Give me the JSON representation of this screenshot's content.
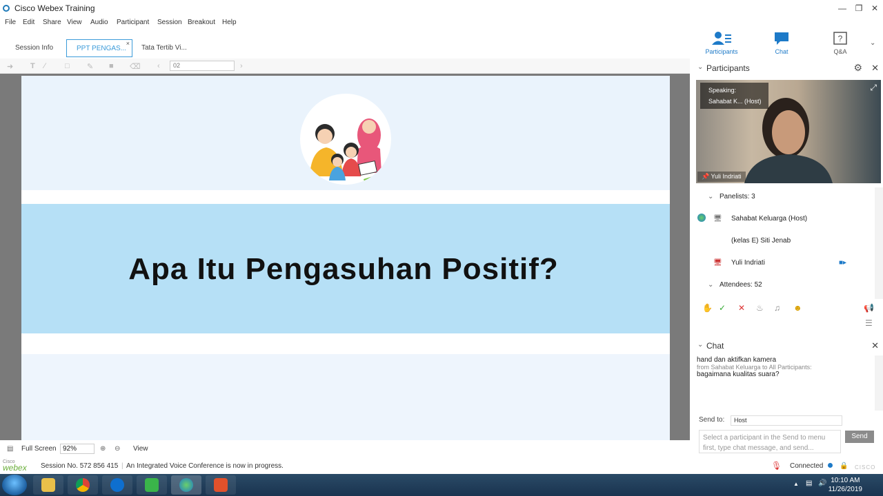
{
  "window": {
    "title": "Cisco Webex Training"
  },
  "menu": [
    "File",
    "Edit",
    "Share",
    "View",
    "Audio",
    "Participant",
    "Session",
    "Breakout",
    "Help"
  ],
  "tabs": [
    {
      "label": "Session Info"
    },
    {
      "label": "PPT PENGAS...",
      "active": true
    },
    {
      "label": "Tata Tertib Vi..."
    }
  ],
  "top_buttons": {
    "participants": "Participants",
    "chat": "Chat",
    "qa": "Q&A"
  },
  "toolbar": {
    "page": "02"
  },
  "slide": {
    "headline": "Apa Itu Pengasuhan Positif?"
  },
  "bottom_bar": {
    "fullscreen": "Full Screen",
    "zoom": "92%",
    "view": "View"
  },
  "status": {
    "brand_top": "Cisco",
    "brand": "webex",
    "session": "Session No. 572 856 415",
    "message": "An Integrated Voice Conference is now in progress.",
    "connected": "Connected",
    "cisco": "CISCO"
  },
  "participants_panel": {
    "title": "Participants",
    "speaking_label": "Speaking:",
    "speaking_name": "Sahabat K... (Host)",
    "video_name": "Yuli Indriati",
    "panelists_label": "Panelists: 3",
    "panelists": [
      "Sahabat Keluarga (Host)",
      "(kelas E) Siti Jenab",
      "Yuli Indriati"
    ],
    "attendees_label": "Attendees: 52"
  },
  "chat_panel": {
    "title": "Chat",
    "messages": [
      {
        "text": "hand dan aktifkan kamera"
      },
      {
        "from": "from Sahabat Keluarga to All Participants:",
        "text": "bagaimana kualitas suara?"
      }
    ],
    "send_to_label": "Send to:",
    "send_to_value": "Host",
    "input_placeholder": "Select a participant in the Send to menu first, type chat message, and send...",
    "send_label": "Send"
  },
  "taskbar": {
    "time": "10:10 AM",
    "date": "11/26/2019"
  },
  "colors": {
    "accent": "#1d7ac8",
    "slide_band": "#b6e0f6",
    "taskbar": "#1a3450"
  }
}
